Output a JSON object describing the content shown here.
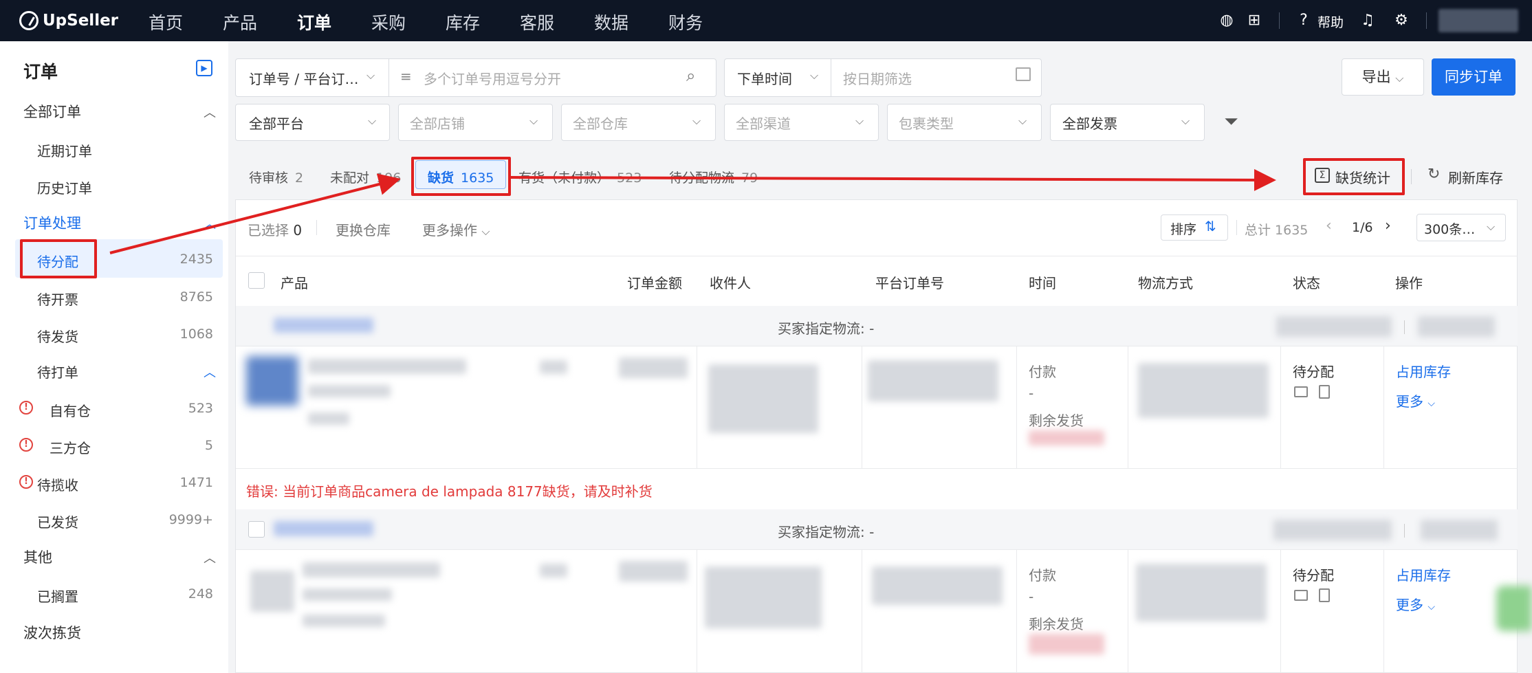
{
  "topnav": {
    "brand": "UpSeller",
    "items": [
      "首页",
      "产品",
      "订单",
      "采购",
      "库存",
      "客服",
      "数据",
      "财务"
    ],
    "active": "订单",
    "help": "帮助"
  },
  "sidebar": {
    "title": "订单",
    "all_orders": "全部订单",
    "recent": "近期订单",
    "history": "历史订单",
    "processing": "订单处理",
    "to_allocate": {
      "label": "待分配",
      "count": "2435"
    },
    "to_invoice": {
      "label": "待开票",
      "count": "8765"
    },
    "to_ship": {
      "label": "待发货",
      "count": "1068"
    },
    "to_print": "待打单",
    "own_wh": {
      "label": "自有仓",
      "count": "523"
    },
    "third_wh": {
      "label": "三方仓",
      "count": "5"
    },
    "to_pickup": {
      "label": "待揽收",
      "count": "1471"
    },
    "shipped": {
      "label": "已发货",
      "count": "9999+"
    },
    "other": "其他",
    "shelved": {
      "label": "已搁置",
      "count": "248"
    },
    "wave": "波次拣货"
  },
  "filters": {
    "order_no_select": "订单号 / 平台订…",
    "order_no_placeholder": "多个订单号用逗号分开",
    "time_select": "下单时间",
    "date_placeholder": "按日期筛选",
    "platform": "全部平台",
    "shop": "全部店铺",
    "warehouse": "全部仓库",
    "channel": "全部渠道",
    "package": "包裹类型",
    "invoice": "全部发票",
    "export": "导出",
    "sync": "同步订单"
  },
  "tabs": [
    {
      "label": "待审核",
      "count": "2"
    },
    {
      "label": "未配对",
      "count": "196"
    },
    {
      "label": "缺货",
      "count": "1635"
    },
    {
      "label": "有货（未付款）",
      "count": "523"
    },
    {
      "label": "待分配物流",
      "count": "79"
    }
  ],
  "right_actions": {
    "shortage_stats": "缺货统计",
    "refresh_stock": "刷新库存"
  },
  "toolbar": {
    "selected_label": "已选择",
    "selected_count": "0",
    "change_wh": "更换仓库",
    "more_ops": "更多操作",
    "sort": "排序",
    "total": "总计 1635",
    "page": "1/6",
    "page_size": "300条…"
  },
  "columns": [
    "产品",
    "订单金额",
    "收件人",
    "平台订单号",
    "时间",
    "物流方式",
    "状态",
    "操作"
  ],
  "orders": [
    {
      "buyer_logistics": "买家指定物流: -",
      "time_paid": "付款",
      "time_dash": "-",
      "time_remaining": "剩余发货",
      "status": "待分配",
      "action_occupy": "占用库存",
      "action_more": "更多"
    },
    {
      "buyer_logistics": "买家指定物流: -",
      "time_paid": "付款",
      "time_dash": "-",
      "time_remaining": "剩余发货",
      "status": "待分配",
      "action_occupy": "占用库存",
      "action_more": "更多"
    }
  ],
  "error_msg": "错误: 当前订单商品camera de lampada 8177缺货，请及时补货",
  "colors": {
    "nav_bg": "#0e1625",
    "accent": "#1a6eea",
    "annotation_red": "#e02020",
    "error_red": "#e23b3b"
  }
}
